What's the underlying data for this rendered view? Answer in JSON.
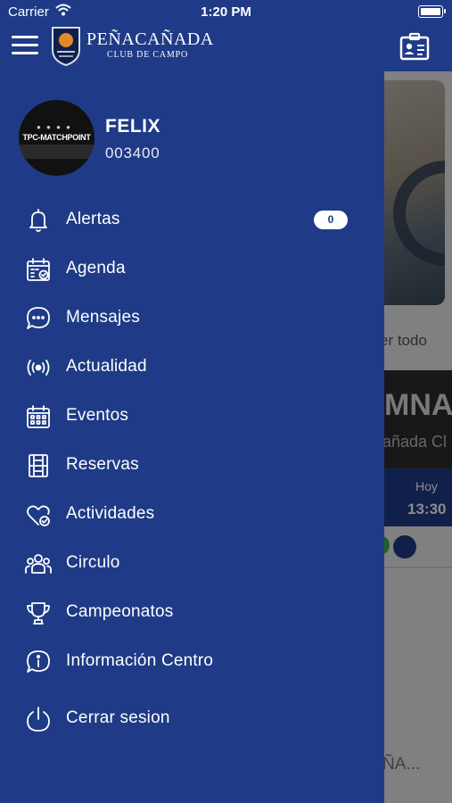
{
  "status_bar": {
    "carrier": "Carrier",
    "time": "1:20 PM"
  },
  "header": {
    "logo_title": "PEÑACAÑADA",
    "logo_subtitle": "CLUB DE CAMPO"
  },
  "user": {
    "avatar_text": "TPC-MATCHPOINT",
    "name": "FELIX",
    "id": "003400"
  },
  "menu": [
    {
      "label": "Alertas",
      "icon": "bell-icon",
      "badge": "0"
    },
    {
      "label": "Agenda",
      "icon": "calendar-check-icon"
    },
    {
      "label": "Mensajes",
      "icon": "chat-icon"
    },
    {
      "label": "Actualidad",
      "icon": "broadcast-icon"
    },
    {
      "label": "Eventos",
      "icon": "calendar-grid-icon"
    },
    {
      "label": "Reservas",
      "icon": "court-icon"
    },
    {
      "label": "Actividades",
      "icon": "heart-check-icon"
    },
    {
      "label": "Circulo",
      "icon": "group-icon"
    },
    {
      "label": "Campeonatos",
      "icon": "trophy-icon"
    },
    {
      "label": "Información Centro",
      "icon": "info-icon"
    },
    {
      "label": "Cerrar sesion",
      "icon": "power-icon"
    }
  ],
  "background": {
    "see_all": "er todo",
    "card_title": "MNAS",
    "card_subtitle": "añada Cl",
    "day": "Hoy",
    "time": "13:30",
    "bottom_text": "ÑA..."
  },
  "colors": {
    "primary": "#1f3b87",
    "background": "#e9e9e9"
  }
}
